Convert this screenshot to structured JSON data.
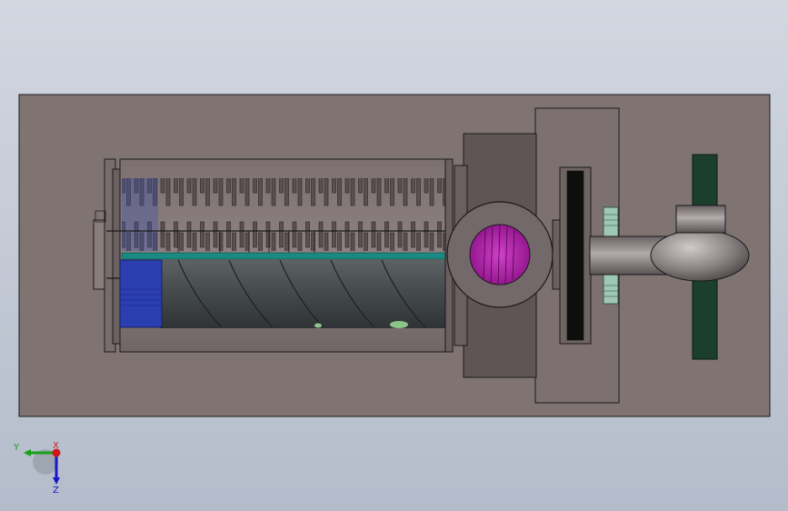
{
  "viewport": {
    "background_top": "#d2d7e0",
    "background_bottom": "#b4bccb"
  },
  "colors": {
    "base_plate": "#7f7472",
    "housing": "#6e6462",
    "screen_drum": "#8c7f7d",
    "screw_body": "#4a4e50",
    "blue_block": "#2b3fb0",
    "teal_band": "#1a8a82",
    "magenta_port": "#b21aa8",
    "green_bar": "#1c3e2d",
    "pipe": "#8a8080",
    "gear": "#9fc7b5",
    "outline": "#1a1a1a"
  },
  "triad": {
    "y_label": "Y",
    "x_label": "X",
    "z_label": "Z",
    "y_color": "#18a018",
    "x_color": "#d01818",
    "z_color": "#1818c8"
  },
  "icons": [
    "coordinate-triad-icon"
  ]
}
